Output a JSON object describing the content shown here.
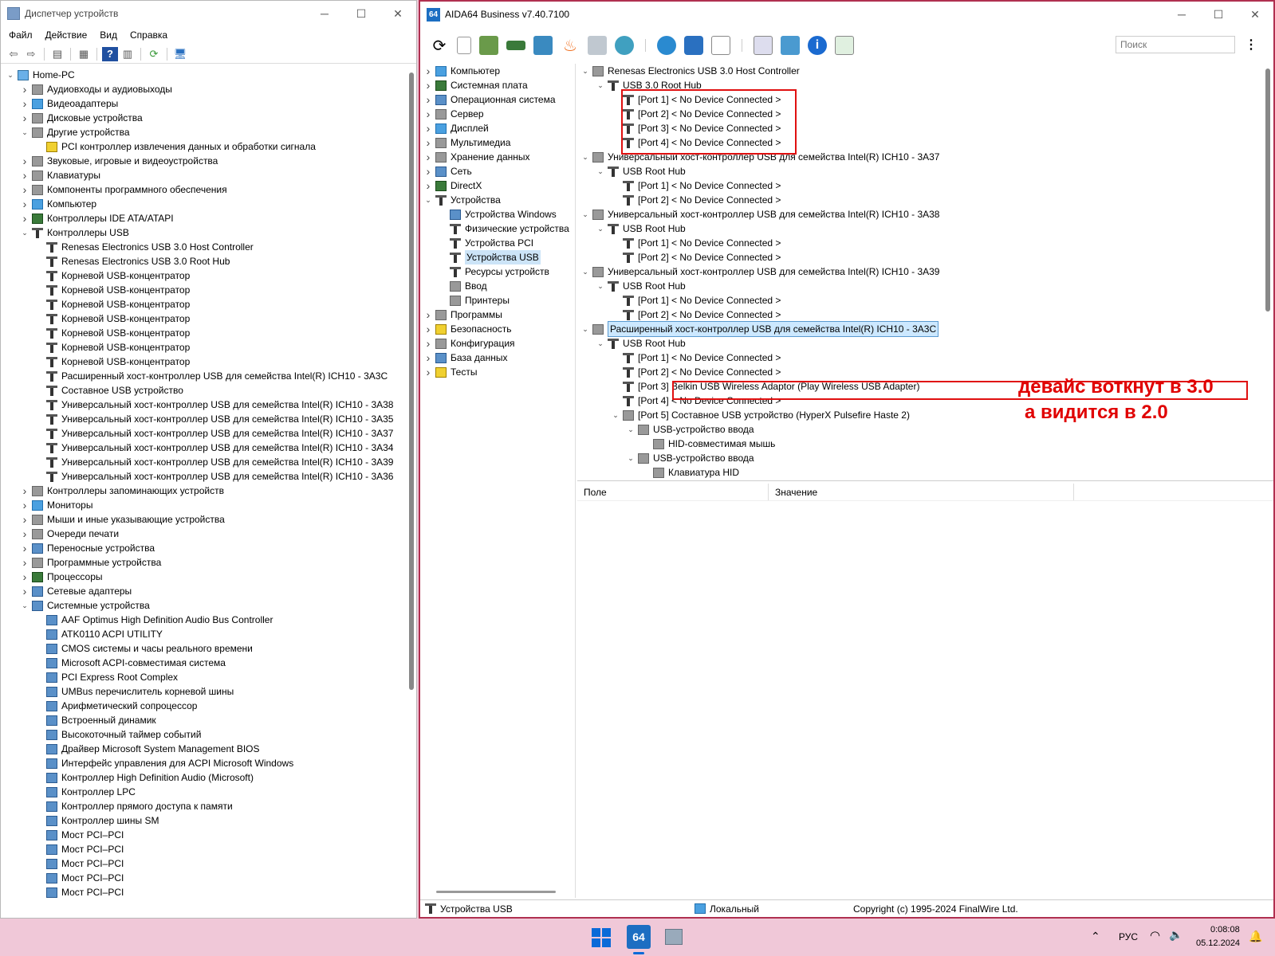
{
  "device_manager": {
    "title": "Диспетчер устройств",
    "menu": [
      "Файл",
      "Действие",
      "Вид",
      "Справка"
    ],
    "tree": [
      {
        "level": 0,
        "exp": "v",
        "icon": "pc",
        "label": "Home-PC"
      },
      {
        "level": 1,
        "exp": ">",
        "icon": "gen",
        "label": "Аудиовходы и аудиовыходы"
      },
      {
        "level": 1,
        "exp": ">",
        "icon": "mon",
        "label": "Видеоадаптеры"
      },
      {
        "level": 1,
        "exp": ">",
        "icon": "gen",
        "label": "Дисковые устройства"
      },
      {
        "level": 1,
        "exp": "v",
        "icon": "gen",
        "label": "Другие устройства"
      },
      {
        "level": 2,
        "exp": "",
        "icon": "warn",
        "label": "PCI контроллер извлечения данных и обработки сигнала"
      },
      {
        "level": 1,
        "exp": ">",
        "icon": "gen",
        "label": "Звуковые, игровые и видеоустройства"
      },
      {
        "level": 1,
        "exp": ">",
        "icon": "gen",
        "label": "Клавиатуры"
      },
      {
        "level": 1,
        "exp": ">",
        "icon": "gen",
        "label": "Компоненты программного обеспечения"
      },
      {
        "level": 1,
        "exp": ">",
        "icon": "mon",
        "label": "Компьютер"
      },
      {
        "level": 1,
        "exp": ">",
        "icon": "chip",
        "label": "Контроллеры IDE ATA/ATAPI"
      },
      {
        "level": 1,
        "exp": "v",
        "icon": "usb",
        "label": "Контроллеры USB"
      },
      {
        "level": 2,
        "exp": "",
        "icon": "usb",
        "label": "Renesas Electronics USB 3.0 Host Controller"
      },
      {
        "level": 2,
        "exp": "",
        "icon": "usb",
        "label": "Renesas Electronics USB 3.0 Root Hub"
      },
      {
        "level": 2,
        "exp": "",
        "icon": "usb",
        "label": "Корневой USB-концентратор"
      },
      {
        "level": 2,
        "exp": "",
        "icon": "usb",
        "label": "Корневой USB-концентратор"
      },
      {
        "level": 2,
        "exp": "",
        "icon": "usb",
        "label": "Корневой USB-концентратор"
      },
      {
        "level": 2,
        "exp": "",
        "icon": "usb",
        "label": "Корневой USB-концентратор"
      },
      {
        "level": 2,
        "exp": "",
        "icon": "usb",
        "label": "Корневой USB-концентратор"
      },
      {
        "level": 2,
        "exp": "",
        "icon": "usb",
        "label": "Корневой USB-концентратор"
      },
      {
        "level": 2,
        "exp": "",
        "icon": "usb",
        "label": "Корневой USB-концентратор"
      },
      {
        "level": 2,
        "exp": "",
        "icon": "usb",
        "label": "Расширенный хост-контроллер USB для семейства Intel(R) ICH10 - 3A3C"
      },
      {
        "level": 2,
        "exp": "",
        "icon": "usb",
        "label": "Составное USB устройство"
      },
      {
        "level": 2,
        "exp": "",
        "icon": "usb",
        "label": "Универсальный хост-контроллер USB для семейства Intel(R) ICH10 - 3A38"
      },
      {
        "level": 2,
        "exp": "",
        "icon": "usb",
        "label": "Универсальный хост-контроллер USB для семейства Intel(R) ICH10 - 3A35"
      },
      {
        "level": 2,
        "exp": "",
        "icon": "usb",
        "label": "Универсальный хост-контроллер USB для семейства Intel(R) ICH10 - 3A37"
      },
      {
        "level": 2,
        "exp": "",
        "icon": "usb",
        "label": "Универсальный хост-контроллер USB для семейства Intel(R) ICH10 - 3A34"
      },
      {
        "level": 2,
        "exp": "",
        "icon": "usb",
        "label": "Универсальный хост-контроллер USB для семейства Intel(R) ICH10 - 3A39"
      },
      {
        "level": 2,
        "exp": "",
        "icon": "usb",
        "label": "Универсальный хост-контроллер USB для семейства Intel(R) ICH10 - 3A36"
      },
      {
        "level": 1,
        "exp": ">",
        "icon": "gen",
        "label": "Контроллеры запоминающих устройств"
      },
      {
        "level": 1,
        "exp": ">",
        "icon": "mon",
        "label": "Мониторы"
      },
      {
        "level": 1,
        "exp": ">",
        "icon": "gen",
        "label": "Мыши и иные указывающие устройства"
      },
      {
        "level": 1,
        "exp": ">",
        "icon": "gen",
        "label": "Очереди печати"
      },
      {
        "level": 1,
        "exp": ">",
        "icon": "sys",
        "label": "Переносные устройства"
      },
      {
        "level": 1,
        "exp": ">",
        "icon": "gen",
        "label": "Программные устройства"
      },
      {
        "level": 1,
        "exp": ">",
        "icon": "chip",
        "label": "Процессоры"
      },
      {
        "level": 1,
        "exp": ">",
        "icon": "sys",
        "label": "Сетевые адаптеры"
      },
      {
        "level": 1,
        "exp": "v",
        "icon": "sys",
        "label": "Системные устройства"
      },
      {
        "level": 2,
        "exp": "",
        "icon": "sys",
        "label": "AAF Optimus High Definition Audio Bus Controller"
      },
      {
        "level": 2,
        "exp": "",
        "icon": "sys",
        "label": "ATK0110 ACPI UTILITY"
      },
      {
        "level": 2,
        "exp": "",
        "icon": "sys",
        "label": "CMOS системы и часы реального времени"
      },
      {
        "level": 2,
        "exp": "",
        "icon": "sys",
        "label": "Microsoft ACPI-совместимая система"
      },
      {
        "level": 2,
        "exp": "",
        "icon": "sys",
        "label": "PCI Express Root Complex"
      },
      {
        "level": 2,
        "exp": "",
        "icon": "sys",
        "label": "UMBus перечислитель корневой шины"
      },
      {
        "level": 2,
        "exp": "",
        "icon": "sys",
        "label": "Арифметический сопроцессор"
      },
      {
        "level": 2,
        "exp": "",
        "icon": "sys",
        "label": "Встроенный динамик"
      },
      {
        "level": 2,
        "exp": "",
        "icon": "sys",
        "label": "Высокоточный таймер событий"
      },
      {
        "level": 2,
        "exp": "",
        "icon": "sys",
        "label": "Драйвер Microsoft System Management BIOS"
      },
      {
        "level": 2,
        "exp": "",
        "icon": "sys",
        "label": "Интерфейс управления для ACPI Microsoft Windows"
      },
      {
        "level": 2,
        "exp": "",
        "icon": "sys",
        "label": "Контроллер High Definition Audio (Microsoft)"
      },
      {
        "level": 2,
        "exp": "",
        "icon": "sys",
        "label": "Контроллер LPC"
      },
      {
        "level": 2,
        "exp": "",
        "icon": "sys",
        "label": "Контроллер прямого доступа к памяти"
      },
      {
        "level": 2,
        "exp": "",
        "icon": "sys",
        "label": "Контроллер шины SM"
      },
      {
        "level": 2,
        "exp": "",
        "icon": "sys",
        "label": "Мост PCI–PCI"
      },
      {
        "level": 2,
        "exp": "",
        "icon": "sys",
        "label": "Мост PCI–PCI"
      },
      {
        "level": 2,
        "exp": "",
        "icon": "sys",
        "label": "Мост PCI–PCI"
      },
      {
        "level": 2,
        "exp": "",
        "icon": "sys",
        "label": "Мост PCI–PCI"
      },
      {
        "level": 2,
        "exp": "",
        "icon": "sys",
        "label": "Мост PCI–PCI"
      }
    ]
  },
  "aida": {
    "title": "AIDA64 Business v7.40.7100",
    "app_icon_text": "64",
    "search_placeholder": "Поиск",
    "nav": [
      {
        "level": 0,
        "exp": ">",
        "icon": "mon",
        "label": "Компьютер"
      },
      {
        "level": 0,
        "exp": ">",
        "icon": "chip",
        "label": "Системная плата"
      },
      {
        "level": 0,
        "exp": ">",
        "icon": "sys",
        "label": "Операционная система"
      },
      {
        "level": 0,
        "exp": ">",
        "icon": "gen",
        "label": "Сервер"
      },
      {
        "level": 0,
        "exp": ">",
        "icon": "mon",
        "label": "Дисплей"
      },
      {
        "level": 0,
        "exp": ">",
        "icon": "gen",
        "label": "Мультимедиа"
      },
      {
        "level": 0,
        "exp": ">",
        "icon": "gen",
        "label": "Хранение данных"
      },
      {
        "level": 0,
        "exp": ">",
        "icon": "sys",
        "label": "Сеть"
      },
      {
        "level": 0,
        "exp": ">",
        "icon": "chip",
        "label": "DirectX"
      },
      {
        "level": 0,
        "exp": "v",
        "icon": "usb",
        "label": "Устройства"
      },
      {
        "level": 1,
        "exp": "",
        "icon": "sys",
        "label": "Устройства Windows"
      },
      {
        "level": 1,
        "exp": "",
        "icon": "usb",
        "label": "Физические устройства"
      },
      {
        "level": 1,
        "exp": "",
        "icon": "usb",
        "label": "Устройства PCI"
      },
      {
        "level": 1,
        "exp": "",
        "icon": "usb",
        "label": "Устройства USB",
        "selected": true
      },
      {
        "level": 1,
        "exp": "",
        "icon": "usb",
        "label": "Ресурсы устройств"
      },
      {
        "level": 1,
        "exp": "",
        "icon": "gen",
        "label": "Ввод"
      },
      {
        "level": 1,
        "exp": "",
        "icon": "gen",
        "label": "Принтеры"
      },
      {
        "level": 0,
        "exp": ">",
        "icon": "gen",
        "label": "Программы"
      },
      {
        "level": 0,
        "exp": ">",
        "icon": "warn",
        "label": "Безопасность"
      },
      {
        "level": 0,
        "exp": ">",
        "icon": "gen",
        "label": "Конфигурация"
      },
      {
        "level": 0,
        "exp": ">",
        "icon": "sys",
        "label": "База данных"
      },
      {
        "level": 0,
        "exp": ">",
        "icon": "warn",
        "label": "Тесты"
      }
    ],
    "usb_tree": [
      {
        "level": 0,
        "exp": "v",
        "icon": "gen",
        "label": "Renesas Electronics USB 3.0 Host Controller"
      },
      {
        "level": 1,
        "exp": "v",
        "icon": "usb",
        "label": "USB 3.0 Root Hub"
      },
      {
        "level": 2,
        "exp": "",
        "icon": "usb",
        "label": "[Port 1] < No Device Connected >"
      },
      {
        "level": 2,
        "exp": "",
        "icon": "usb",
        "label": "[Port 2] < No Device Connected >"
      },
      {
        "level": 2,
        "exp": "",
        "icon": "usb",
        "label": "[Port 3] < No Device Connected >"
      },
      {
        "level": 2,
        "exp": "",
        "icon": "usb",
        "label": "[Port 4] < No Device Connected >"
      },
      {
        "level": 0,
        "exp": "v",
        "icon": "gen",
        "label": "Универсальный хост-контроллер USB для семейства Intel(R) ICH10 - 3A37"
      },
      {
        "level": 1,
        "exp": "v",
        "icon": "usb",
        "label": "USB Root Hub"
      },
      {
        "level": 2,
        "exp": "",
        "icon": "usb",
        "label": "[Port 1] < No Device Connected >"
      },
      {
        "level": 2,
        "exp": "",
        "icon": "usb",
        "label": "[Port 2] < No Device Connected >"
      },
      {
        "level": 0,
        "exp": "v",
        "icon": "gen",
        "label": "Универсальный хост-контроллер USB для семейства Intel(R) ICH10 - 3A38"
      },
      {
        "level": 1,
        "exp": "v",
        "icon": "usb",
        "label": "USB Root Hub"
      },
      {
        "level": 2,
        "exp": "",
        "icon": "usb",
        "label": "[Port 1] < No Device Connected >"
      },
      {
        "level": 2,
        "exp": "",
        "icon": "usb",
        "label": "[Port 2] < No Device Connected >"
      },
      {
        "level": 0,
        "exp": "v",
        "icon": "gen",
        "label": "Универсальный хост-контроллер USB для семейства Intel(R) ICH10 - 3A39"
      },
      {
        "level": 1,
        "exp": "v",
        "icon": "usb",
        "label": "USB Root Hub"
      },
      {
        "level": 2,
        "exp": "",
        "icon": "usb",
        "label": "[Port 1] < No Device Connected >"
      },
      {
        "level": 2,
        "exp": "",
        "icon": "usb",
        "label": "[Port 2] < No Device Connected >"
      },
      {
        "level": 0,
        "exp": "v",
        "icon": "gen",
        "label": "Расширенный хост-контроллер USB для семейства Intel(R) ICH10 - 3A3C",
        "selected": true
      },
      {
        "level": 1,
        "exp": "v",
        "icon": "usb",
        "label": "USB Root Hub"
      },
      {
        "level": 2,
        "exp": "",
        "icon": "usb",
        "label": "[Port 1] < No Device Connected >"
      },
      {
        "level": 2,
        "exp": "",
        "icon": "usb",
        "label": "[Port 2] < No Device Connected >"
      },
      {
        "level": 2,
        "exp": "",
        "icon": "usb",
        "label": "[Port 3] Belkin USB Wireless Adaptor (Play Wireless USB Adapter)"
      },
      {
        "level": 2,
        "exp": "",
        "icon": "usb",
        "label": "[Port 4] < No Device Connected >"
      },
      {
        "level": 2,
        "exp": "v",
        "icon": "gen",
        "label": "[Port 5] Составное USB устройство (HyperX Pulsefire Haste 2)"
      },
      {
        "level": 3,
        "exp": "v",
        "icon": "gen",
        "label": "USB-устройство ввода"
      },
      {
        "level": 4,
        "exp": "",
        "icon": "gen",
        "label": "HID-совместимая мышь"
      },
      {
        "level": 3,
        "exp": "v",
        "icon": "gen",
        "label": "USB-устройство ввода"
      },
      {
        "level": 4,
        "exp": "",
        "icon": "gen",
        "label": "Клавиатура HID"
      }
    ],
    "columns": [
      "Поле",
      "Значение"
    ],
    "annotation_line1": "девайс воткнут в 3.0",
    "annotation_line2": "а видится в 2.0",
    "status": {
      "left": "Устройства USB",
      "mid": "Локальный",
      "right": "Copyright (c) 1995-2024 FinalWire Ltd."
    }
  },
  "taskbar": {
    "lang": "РУС",
    "time": "0:08:08",
    "date": "05.12.2024",
    "aida_icon": "64"
  }
}
